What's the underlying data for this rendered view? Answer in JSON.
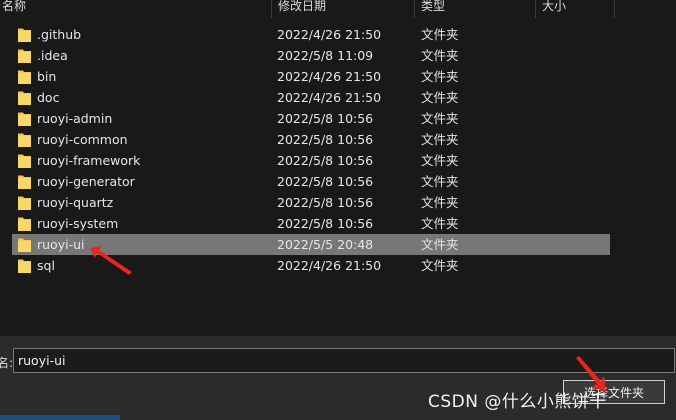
{
  "columns": {
    "name": "名称",
    "date": "修改日期",
    "type": "类型",
    "size": "大小"
  },
  "files": [
    {
      "name": ".github",
      "date": "2022/4/26 21:50",
      "type": "文件夹"
    },
    {
      "name": ".idea",
      "date": "2022/5/8 11:09",
      "type": "文件夹"
    },
    {
      "name": "bin",
      "date": "2022/4/26 21:50",
      "type": "文件夹"
    },
    {
      "name": "doc",
      "date": "2022/4/26 21:50",
      "type": "文件夹"
    },
    {
      "name": "ruoyi-admin",
      "date": "2022/5/8 10:56",
      "type": "文件夹"
    },
    {
      "name": "ruoyi-common",
      "date": "2022/5/8 10:56",
      "type": "文件夹"
    },
    {
      "name": "ruoyi-framework",
      "date": "2022/5/8 10:56",
      "type": "文件夹"
    },
    {
      "name": "ruoyi-generator",
      "date": "2022/5/8 10:56",
      "type": "文件夹"
    },
    {
      "name": "ruoyi-quartz",
      "date": "2022/5/8 10:56",
      "type": "文件夹"
    },
    {
      "name": "ruoyi-system",
      "date": "2022/5/8 10:56",
      "type": "文件夹"
    },
    {
      "name": "ruoyi-ui",
      "date": "2022/5/5 20:48",
      "type": "文件夹",
      "selected": true
    },
    {
      "name": "sql",
      "date": "2022/4/26 21:50",
      "type": "文件夹"
    }
  ],
  "footer": {
    "filename_label": "名:",
    "filename_value": "ruoyi-ui",
    "select_button_label": "选择文件夹"
  },
  "watermark": "CSDN @什么小熊饼干",
  "colors": {
    "background": "#191919",
    "selected_row": "#777777",
    "folder": "#f6c94e",
    "arrow": "#e8261c"
  },
  "icons": {
    "folder": "folder-icon",
    "annotation": "red-arrow-icon"
  }
}
